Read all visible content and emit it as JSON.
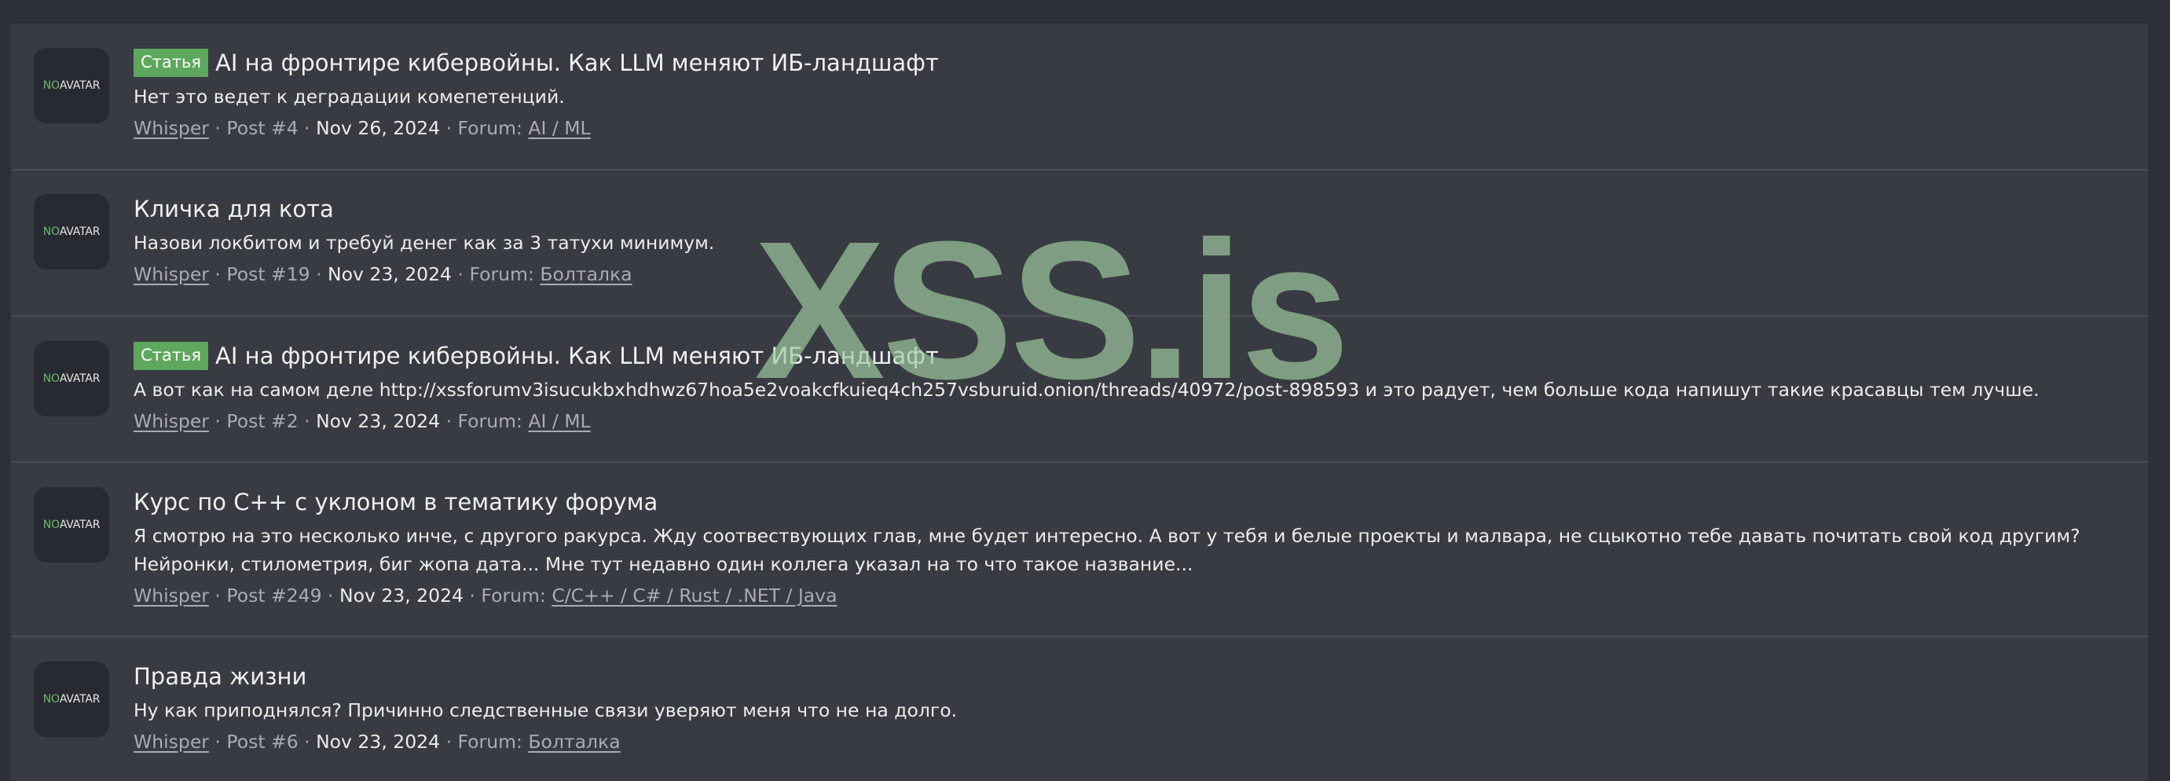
{
  "avatar_text": {
    "no": "NO",
    "avatar": "AVATAR"
  },
  "watermark": "XSS.is",
  "colors": {
    "prefix_bg": "#5ea85e",
    "avatar_no": "#6fb870",
    "panel_bg": "#383b41",
    "page_bg": "#2d3037"
  },
  "results": [
    {
      "prefix": "Статья",
      "title": "AI на фронтире кибервойны. Как LLM меняют ИБ-ландшафт",
      "snippet": "Нет это ведет к деградации комепетенций.",
      "author": "Whisper",
      "post": "Post #4",
      "date": "Nov 26, 2024",
      "forum_label": "Forum:",
      "forum": "AI / ML"
    },
    {
      "prefix": "",
      "title": "Кличка для кота",
      "snippet": "Назови локбитом и требуй денег как за 3 татухи минимум.",
      "author": "Whisper",
      "post": "Post #19",
      "date": "Nov 23, 2024",
      "forum_label": "Forum:",
      "forum": "Болталка"
    },
    {
      "prefix": "Статья",
      "title": "AI на фронтире кибервойны. Как LLM меняют ИБ-ландшафт",
      "snippet": "А вот как на самом деле http://xssforumv3isucukbxhdhwz67hoa5e2voakcfkuieq4ch257vsburuid.onion/threads/40972/post-898593 и это радует, чем больше кода напишут такие красавцы тем лучше.",
      "author": "Whisper",
      "post": "Post #2",
      "date": "Nov 23, 2024",
      "forum_label": "Forum:",
      "forum": "AI / ML"
    },
    {
      "prefix": "",
      "title": "Курс по C++ с уклоном в тематику форума",
      "snippet": "Я смотрю на это несколько инче, с другого ракурса. Жду соотвествующих глав, мне будет интересно. А вот у тебя и белые проекты и малвара, не сцыкотно тебе давать почитать свой код другим? Нейронки, стилометрия, биг жопа дата... Мне тут недавно один коллега указал на то что такое название...",
      "author": "Whisper",
      "post": "Post #249",
      "date": "Nov 23, 2024",
      "forum_label": "Forum:",
      "forum": "C/C++ / C# / Rust / .NET / Java"
    },
    {
      "prefix": "",
      "title": "Правда жизни",
      "snippet": "Ну как приподнялся? Причинно следственные связи уверяют меня что не на долго.",
      "author": "Whisper",
      "post": "Post #6",
      "date": "Nov 23, 2024",
      "forum_label": "Forum:",
      "forum": "Болталка"
    }
  ]
}
